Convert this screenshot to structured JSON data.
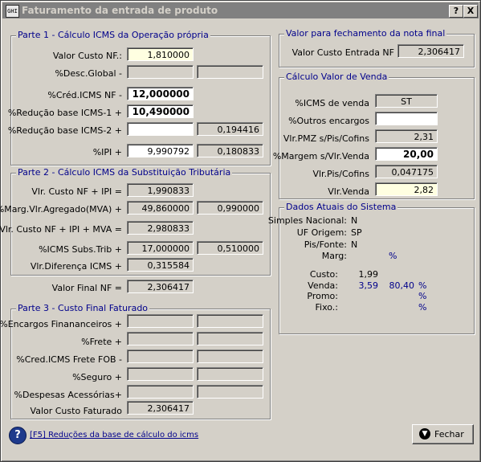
{
  "window": {
    "title": "Faturamento da entrada de produto",
    "icon": "app-icon",
    "help_btn": "?",
    "close_btn": "X"
  },
  "parte1": {
    "title": "Parte 1 - Cálculo ICMS da Operação própria",
    "rows": [
      {
        "label": "Valor Custo NF.:",
        "value": "1,810000",
        "value2": ""
      },
      {
        "label": "%Desc.Global -",
        "value": "",
        "value2": ""
      },
      {
        "label": "%Créd.ICMS NF -",
        "value": "12,000000",
        "value2": ""
      },
      {
        "label": "%Redução base ICMS-1 +",
        "value": "10,490000",
        "value2": ""
      },
      {
        "label": "%Redução base ICMS-2 +",
        "value": "",
        "value2": "0,194416"
      },
      {
        "label": "%IPI +",
        "value": "9,990792",
        "value2": "0,180833"
      }
    ]
  },
  "parte2": {
    "title": "Parte 2 - Cálculo ICMS da Substituição Tributária",
    "rows": [
      {
        "label": "Vlr. Custo NF + IPI =",
        "value": "1,990833",
        "value2": ""
      },
      {
        "label": "%Marg.Vlr.Agregado(MVA) +",
        "value": "49,860000",
        "value2": "0,990000"
      },
      {
        "label": "Vlr. Custo NF + IPI  + MVA =",
        "value": "2,980833",
        "value2": ""
      },
      {
        "label": "%ICMS Subs.Trib +",
        "value": "17,000000",
        "value2": "0,510000"
      },
      {
        "label": "Vlr.Diferença ICMS +",
        "value": "0,315584",
        "value2": ""
      }
    ]
  },
  "valor_final": {
    "label": "Valor Final NF =",
    "value": "2,306417"
  },
  "parte3": {
    "title": "Parte 3 - Custo Final Faturado",
    "rows": [
      {
        "label": "%Encargos Finananceiros +",
        "value": "",
        "value2": ""
      },
      {
        "label": "%Frete +",
        "value": "",
        "value2": ""
      },
      {
        "label": "%Cred.ICMS Frete FOB -",
        "value": "",
        "value2": ""
      },
      {
        "label": "%Seguro +",
        "value": "",
        "value2": ""
      },
      {
        "label": "%Despesas Acessórias+",
        "value": "",
        "value2": ""
      },
      {
        "label": "Valor Custo Faturado",
        "value": "2,306417",
        "value2": ""
      }
    ]
  },
  "fechamento": {
    "title": "Valor para fechamento da nota final",
    "label": "Valor Custo Entrada NF",
    "value": "2,306417"
  },
  "venda": {
    "title": "Cálculo Valor de Venda",
    "rows": [
      {
        "label": "%ICMS de venda",
        "value": "ST"
      },
      {
        "label": "%Outros encargos",
        "value": ""
      },
      {
        "label": "Vlr.PMZ s/Pis/Cofins",
        "value": "2,31"
      },
      {
        "label": "%Margem s/Vlr.Venda",
        "value": "20,00"
      },
      {
        "label": "Vlr.Pis/Cofins",
        "value": "0,047175"
      },
      {
        "label": "Vlr.Venda",
        "value": "2,82"
      }
    ]
  },
  "dados": {
    "title": "Dados Atuais do Sistema",
    "simples_label": "Simples Nacional:",
    "simples_value": "N",
    "uf_label": "UF Origem:",
    "uf_value": "SP",
    "pis_label": "Pis/Fonte:",
    "pis_value": "N",
    "marg_label": "Marg:",
    "marg_value": "%",
    "custo_label": "Custo:",
    "custo_value": "1,99",
    "venda_label": "Venda:",
    "venda_value": "3,59",
    "venda_pct": "80,40",
    "venda_pct_sym": "%",
    "promo_label": "Promo:",
    "promo_pct_sym": "%",
    "fixo_label": "Fixo.:",
    "fixo_pct_sym": "%"
  },
  "footer": {
    "link": "[F5] Reduções da base de cálculo do icms",
    "close_label": "Fechar"
  },
  "colors": {
    "title_inactive": "#808080",
    "group_title": "#00008b",
    "input_yellow": "#ffffe1"
  }
}
